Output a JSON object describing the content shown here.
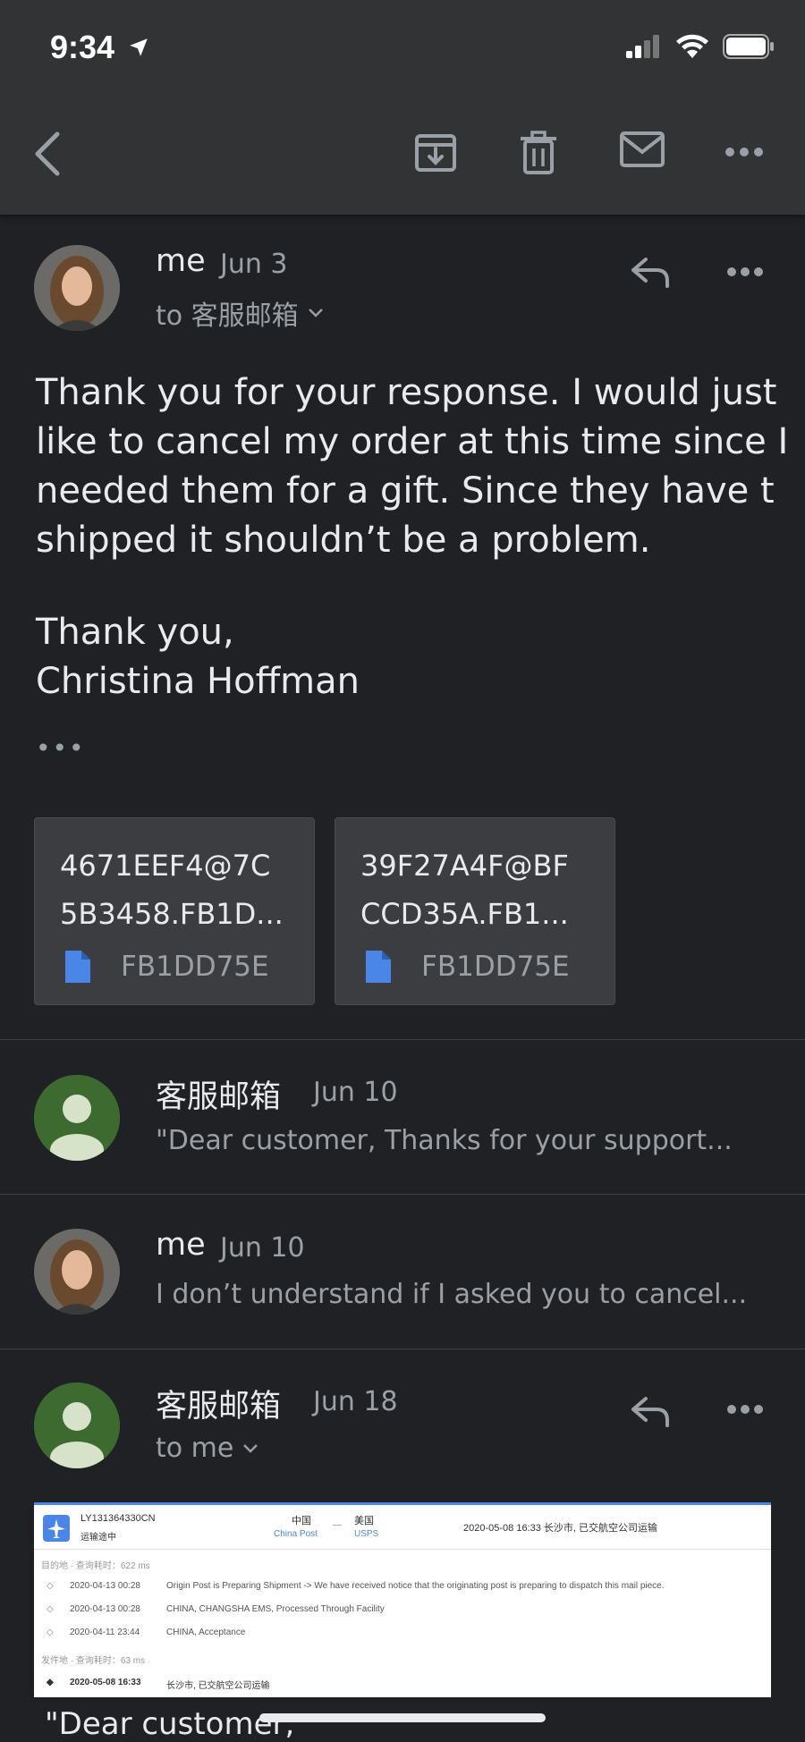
{
  "status_bar": {
    "time": "9:34"
  },
  "messages": [
    {
      "sender": "me",
      "date": "Jun 3",
      "recipient": "to 客服邮箱",
      "body": [
        "Thank you for your response. I would just",
        "like to cancel my order at this time since I",
        "needed them for a gift. Since they have t",
        "shipped it shouldn’t be a problem."
      ],
      "sign_off": "Thank you,",
      "signature": "Christina Hoffman",
      "quoted": "•••",
      "attachments": [
        {
          "name": "4671EEF4@7C\n5B3458.FB1D...",
          "file": "FB1DD75E"
        },
        {
          "name": "39F27A4F@BF\nCCD35A.FB1...",
          "file": "FB1DD75E"
        }
      ]
    },
    {
      "sender": "客服邮箱",
      "date": "Jun 10",
      "snippet": "\"Dear customer, Thanks for your support..."
    },
    {
      "sender": "me",
      "date": "Jun 10",
      "snippet": "I don’t understand if I asked you to cancel..."
    },
    {
      "sender": "客服邮箱",
      "date": "Jun 18",
      "recipient": "to me",
      "body_start": "\"Dear customer,"
    }
  ],
  "tracking": {
    "number": "LY131364330CN",
    "status": "运输途中",
    "from_country": "中国",
    "from_carrier": "China Post",
    "to_country": "美国",
    "to_carrier": "USPS",
    "latest": "2020-05-08 16:33  长沙市, 已交航空公司运输",
    "dest_label": "目的地 · 查询耗时：622 ms",
    "dest_events": [
      {
        "time": "2020-04-13 00:28",
        "text": "Origin Post is Preparing Shipment -> We have received notice that the originating post is preparing to dispatch this mail piece."
      },
      {
        "time": "2020-04-13 00:28",
        "text": "CHINA, CHANGSHA EMS, Processed Through Facility"
      },
      {
        "time": "2020-04-11 23:44",
        "text": "CHINA, Acceptance"
      }
    ],
    "origin_label": "发件地 · 查询耗时：63 ms",
    "origin_events": [
      {
        "time": "2020-05-08 16:33",
        "text": "长沙市, 已交航空公司运输"
      }
    ]
  },
  "colors": {
    "background": "#202124",
    "toolbar": "#323335",
    "accent_blue": "#4a86e8",
    "avatar_green": "#3d6b2f"
  }
}
